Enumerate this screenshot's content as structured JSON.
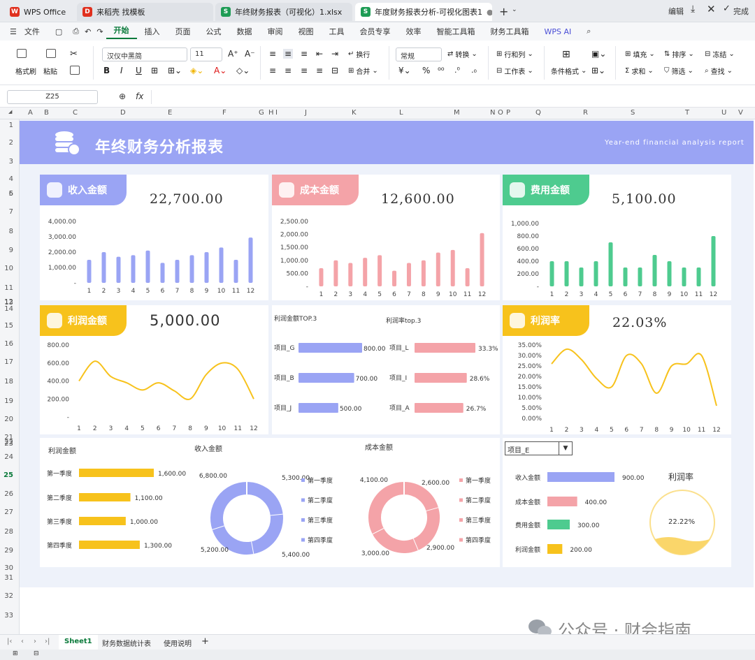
{
  "tabs": [
    {
      "label": "WPS Office",
      "icon": "wps-logo-icon",
      "color": "#e0301e"
    },
    {
      "label": "来稻壳 找模板",
      "icon": "docer-icon",
      "color": "#e0301e"
    },
    {
      "label": "年终财务报表（可视化）1.xlsx",
      "icon": "sheet-icon",
      "color": "#1e9c55"
    },
    {
      "label": "年度财务报表分析-可视化图表1",
      "icon": "sheet-icon",
      "color": "#1e9c55"
    }
  ],
  "titlebar": {
    "edit": "编辑",
    "done": "完成"
  },
  "menu": [
    "文件",
    "开始",
    "插入",
    "页面",
    "公式",
    "数据",
    "审阅",
    "视图",
    "工具",
    "会员专享",
    "效率",
    "智能工具箱",
    "财务工具箱",
    "WPS AI"
  ],
  "ribbon": {
    "format_painter": "格式刷",
    "paste": "粘贴",
    "font": "汉仪中黑简",
    "size": "11",
    "wrap": "换行",
    "merge": "合并",
    "numfmt": "常规",
    "convert": "转换",
    "rowcol": "行和列",
    "worksheet": "工作表",
    "condfmt": "条件格式",
    "fill": "填充",
    "sort": "排序",
    "freeze": "冻结",
    "sum": "求和",
    "filter": "筛选",
    "find": "查找"
  },
  "formula": {
    "cell": "Z25",
    "fx": "fx"
  },
  "columns": [
    "A",
    "B",
    "C",
    "D",
    "E",
    "F",
    "G",
    "H",
    "I",
    "J",
    "K",
    "L",
    "M",
    "N",
    "O",
    "P",
    "Q",
    "R",
    "S",
    "T",
    "U",
    "V"
  ],
  "rows": [
    "1",
    "2",
    "3",
    "4",
    "5",
    "6",
    "7",
    "8",
    "9",
    "10",
    "11",
    "12",
    "13",
    "14",
    "15",
    "16",
    "17",
    "18",
    "19",
    "20",
    "21",
    "22",
    "23",
    "24",
    "25",
    "26",
    "27",
    "28",
    "29",
    "30",
    "31",
    "32",
    "33"
  ],
  "dashboard": {
    "title": "年终财务分析报表",
    "subtitle": "Year-end financial analysis report",
    "colors": {
      "blue": "#9aa4f4",
      "pink": "#f4a3a8",
      "green": "#4ecb8f",
      "yellow": "#f7c21c"
    },
    "revenue": {
      "label": "收入金额",
      "total": "22,700.00"
    },
    "cost": {
      "label": "成本金额",
      "total": "12,600.00"
    },
    "expense": {
      "label": "费用金额",
      "total": "5,100.00"
    },
    "profit": {
      "label": "利润金额",
      "total": "5,000.00"
    },
    "rate": {
      "label": "利润率",
      "total": "22.03%"
    },
    "top_profit_title": "利润金额TOP.3",
    "top_rate_title": "利润率top.3",
    "q_profit_title": "利润金额",
    "q_rev_title": "收入金额",
    "q_cost_title": "成本金额",
    "project_select": "项目_E",
    "gauge_title": "利润率",
    "gauge_value": "22.22%"
  },
  "chart_data": [
    {
      "type": "bar",
      "name": "收入金额",
      "categories": [
        "1",
        "2",
        "3",
        "4",
        "5",
        "6",
        "7",
        "8",
        "9",
        "10",
        "11",
        "12"
      ],
      "values": [
        1500,
        2000,
        1700,
        1800,
        2100,
        1300,
        1500,
        1800,
        2000,
        2300,
        1500,
        2950
      ],
      "ylim": [
        0,
        4000
      ],
      "yticks": [
        "4,000.00",
        "3,000.00",
        "2,000.00",
        "1,000.00",
        "-"
      ]
    },
    {
      "type": "bar",
      "name": "成本金额",
      "categories": [
        "1",
        "2",
        "3",
        "4",
        "5",
        "6",
        "7",
        "8",
        "9",
        "10",
        "11",
        "12"
      ],
      "values": [
        700,
        1000,
        900,
        1100,
        1200,
        600,
        900,
        1000,
        1300,
        1400,
        700,
        2050
      ],
      "ylim": [
        0,
        2500
      ],
      "yticks": [
        "2,500.00",
        "2,000.00",
        "1,500.00",
        "1,000.00",
        "500.00",
        "-"
      ]
    },
    {
      "type": "bar",
      "name": "费用金额",
      "categories": [
        "1",
        "2",
        "3",
        "4",
        "5",
        "6",
        "7",
        "8",
        "9",
        "10",
        "11",
        "12"
      ],
      "values": [
        400,
        400,
        300,
        400,
        700,
        300,
        300,
        500,
        400,
        300,
        300,
        800
      ],
      "ylim": [
        0,
        1000
      ],
      "yticks": [
        "1,000.00",
        "800.00",
        "600.00",
        "400.00",
        "200.00",
        "-"
      ]
    },
    {
      "type": "line",
      "name": "利润金额",
      "categories": [
        "1",
        "2",
        "3",
        "4",
        "5",
        "6",
        "7",
        "8",
        "9",
        "10",
        "11",
        "12"
      ],
      "values": [
        400,
        620,
        450,
        380,
        300,
        380,
        290,
        200,
        470,
        600,
        530,
        200
      ],
      "ylim": [
        0,
        800
      ],
      "yticks": [
        "800.00",
        "600.00",
        "400.00",
        "200.00",
        "-"
      ]
    },
    {
      "type": "line",
      "name": "利润率",
      "categories": [
        "1",
        "2",
        "3",
        "4",
        "5",
        "6",
        "7",
        "8",
        "9",
        "10",
        "11",
        "12"
      ],
      "values": [
        26,
        33,
        28,
        19,
        15,
        30,
        26,
        12,
        25,
        26,
        30,
        6
      ],
      "ylim": [
        0,
        35
      ],
      "yticks": [
        "35.00%",
        "30.00%",
        "25.00%",
        "20.00%",
        "15.00%",
        "10.00%",
        "5.00%",
        "0.00%"
      ]
    },
    {
      "type": "bar",
      "name": "利润金额TOP.3",
      "categories": [
        "项目_G",
        "项目_B",
        "项目_J"
      ],
      "values": [
        800,
        700,
        500
      ],
      "labels": [
        "800.00",
        "700.00",
        "500.00"
      ]
    },
    {
      "type": "bar",
      "name": "利润率top.3",
      "categories": [
        "项目_L",
        "项目_I",
        "项目_A"
      ],
      "values": [
        33.3,
        28.6,
        26.7
      ],
      "labels": [
        "33.3%",
        "28.6%",
        "26.7%"
      ]
    },
    {
      "type": "bar",
      "name": "利润金额季度",
      "categories": [
        "第一季度",
        "第二季度",
        "第三季度",
        "第四季度"
      ],
      "values": [
        1600,
        1100,
        1000,
        1300
      ],
      "labels": [
        "1,600.00",
        "1,100.00",
        "1,000.00",
        "1,300.00"
      ]
    },
    {
      "type": "pie",
      "name": "收入金额季度",
      "categories": [
        "第一季度",
        "第二季度",
        "第三季度",
        "第四季度"
      ],
      "values": [
        5300,
        5400,
        5200,
        6800
      ],
      "labels": [
        "5,300.00",
        "5,400.00",
        "5,200.00",
        "6,800.00"
      ]
    },
    {
      "type": "pie",
      "name": "成本金额季度",
      "categories": [
        "第一季度",
        "第二季度",
        "第三季度",
        "第四季度"
      ],
      "values": [
        2600,
        2900,
        3000,
        4100
      ],
      "labels": [
        "2,600.00",
        "2,900.00",
        "3,000.00",
        "4,100.00"
      ]
    },
    {
      "type": "bar",
      "name": "项目_E",
      "categories": [
        "收入金额",
        "成本金额",
        "费用金额",
        "利润金额"
      ],
      "values": [
        900,
        400,
        300,
        200
      ],
      "labels": [
        "900.00",
        "400.00",
        "300.00",
        "200.00"
      ]
    }
  ],
  "sheets": [
    "Sheet1",
    "财务数据统计表",
    "使用说明"
  ],
  "watermark": "公众号 · 财会指南"
}
